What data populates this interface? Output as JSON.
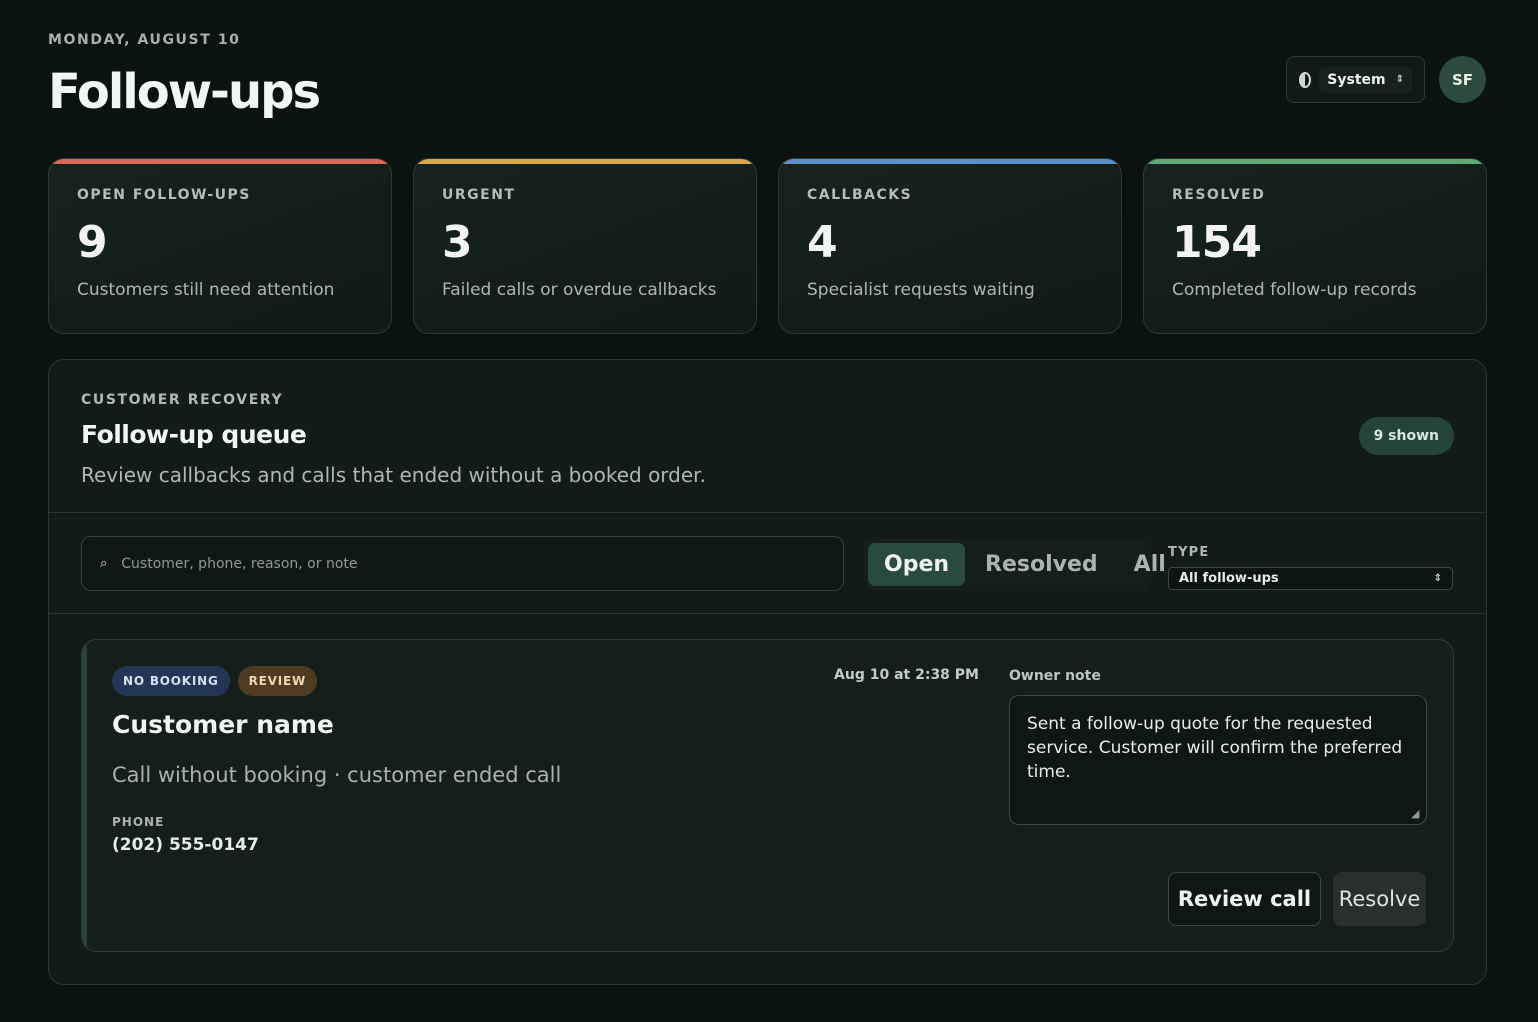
{
  "header": {
    "date": "MONDAY, AUGUST 10",
    "title": "Follow-ups"
  },
  "top_right": {
    "theme_value": "System",
    "theme_icon": "contrast-icon",
    "avatar_initials": "SF"
  },
  "stats": [
    {
      "label": "OPEN FOLLOW-UPS",
      "value": "9",
      "desc": "Customers still need attention",
      "color": "#d9675a"
    },
    {
      "label": "URGENT",
      "value": "3",
      "desc": "Failed calls or overdue callbacks",
      "color": "#d9a84a"
    },
    {
      "label": "CALLBACKS",
      "value": "4",
      "desc": "Specialist requests waiting",
      "color": "#5b91c4"
    },
    {
      "label": "RESOLVED",
      "value": "154",
      "desc": "Completed follow-up records",
      "color": "#5ea975"
    }
  ],
  "panel": {
    "eyebrow": "CUSTOMER RECOVERY",
    "title": "Follow-up queue",
    "subtitle": "Review callbacks and calls that ended without a booked order.",
    "shown_badge": "9 shown"
  },
  "toolbar": {
    "search_placeholder": "Customer, phone, reason, or note",
    "search_icon": "search-icon",
    "filters": [
      "Open",
      "Resolved",
      "All"
    ],
    "active_filter": "Open",
    "type_label": "TYPE",
    "type_value": "All follow-ups"
  },
  "card": {
    "badges": [
      "NO BOOKING",
      "REVIEW"
    ],
    "customer_name": "Customer name",
    "call_desc": "Call without booking · customer ended call",
    "phone_label": "PHONE",
    "phone": "(202) 555-0147",
    "timestamp": "Aug 10 at 2:38 PM",
    "note_label": "Owner note",
    "note": "Sent a follow-up quote for the requested service. Customer will confirm the preferred time.",
    "review_button": "Review call",
    "resolve_button": "Resolve"
  }
}
